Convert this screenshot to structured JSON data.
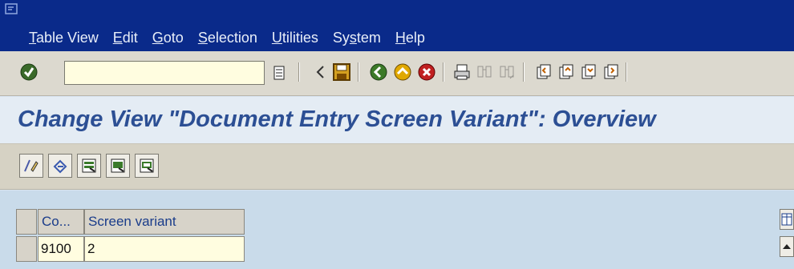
{
  "menubar": {
    "items": [
      {
        "pre": "",
        "u": "T",
        "post": "able View"
      },
      {
        "pre": "",
        "u": "E",
        "post": "dit"
      },
      {
        "pre": "",
        "u": "G",
        "post": "oto"
      },
      {
        "pre": "",
        "u": "S",
        "post": "election"
      },
      {
        "pre": "",
        "u": "U",
        "post": "tilities"
      },
      {
        "pre": "Sy",
        "u": "s",
        "post": "tem"
      },
      {
        "pre": "",
        "u": "H",
        "post": "elp"
      }
    ]
  },
  "toolbar": {
    "command_value": "",
    "icons": [
      "enter-icon",
      "back-arrow-icon",
      "save-icon",
      "back-icon",
      "exit-icon",
      "cancel-icon",
      "print-icon",
      "find-icon",
      "find-next-icon",
      "first-page-icon",
      "previous-page-icon",
      "next-page-icon",
      "last-page-icon"
    ]
  },
  "title": "Change View \"Document Entry Screen Variant\": Overview",
  "app_toolbar": {
    "icons": [
      "display-change-icon",
      "undo-icon",
      "select-all-icon",
      "select-block-icon",
      "deselect-all-icon"
    ]
  },
  "table": {
    "headers": [
      "Co...",
      "Screen variant"
    ],
    "rows": [
      [
        "9100",
        "2"
      ]
    ]
  },
  "colors": {
    "menubar_bg": "#0a2a8a",
    "title_color": "#2c4f94",
    "input_bg": "#fffde0"
  }
}
